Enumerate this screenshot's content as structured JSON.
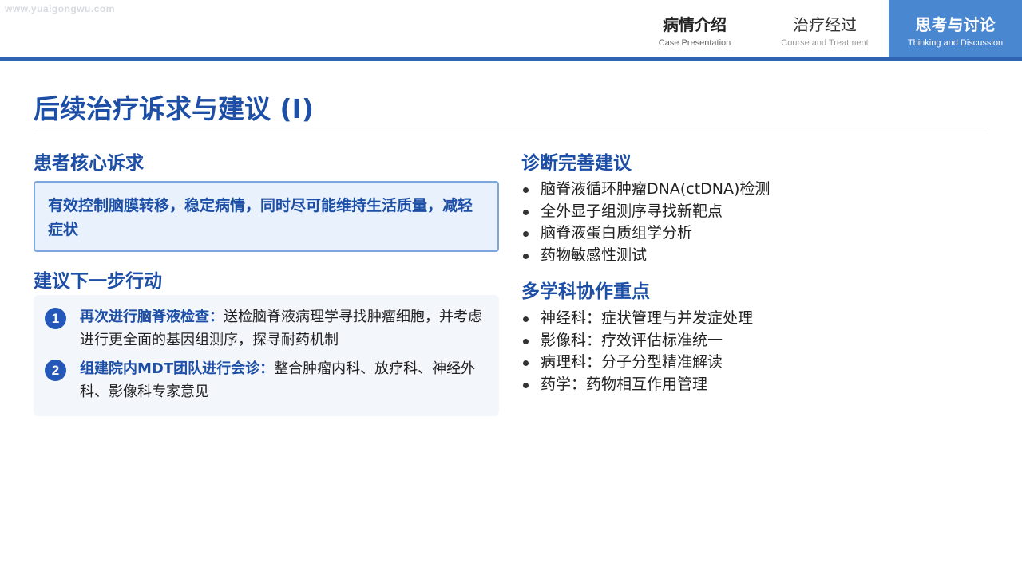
{
  "watermark": "www.yuaigongwu.com",
  "nav": {
    "tabs": [
      {
        "zh": "病情介绍",
        "en": "Case Presentation"
      },
      {
        "zh": "治疗经过",
        "en": "Course and Treatment"
      },
      {
        "zh": "思考与讨论",
        "en": "Thinking and Discussion"
      }
    ],
    "active_index": 2
  },
  "title": "后续治疗诉求与建议 (I)",
  "core": {
    "heading": "患者核心诉求",
    "text": "有效控制脑膜转移，稳定病情，同时尽可能维持生活质量，减轻症状"
  },
  "actions": {
    "heading": "建议下一步行动",
    "items": [
      {
        "num": "1",
        "bold": "再次进行脑脊液检查：",
        "text": "送检脑脊液病理学寻找肿瘤细胞，并考虑进行更全面的基因组测序，探寻耐药机制"
      },
      {
        "num": "2",
        "bold": "组建院内MDT团队进行会诊：",
        "text": "整合肿瘤内科、放疗科、神经外科、影像科专家意见"
      }
    ]
  },
  "diagnosis": {
    "heading": "诊断完善建议",
    "items": [
      "脑脊液循环肿瘤DNA(ctDNA)检测",
      "全外显子组测序寻找新靶点",
      "脑脊液蛋白质组学分析",
      "药物敏感性测试"
    ]
  },
  "mdt": {
    "heading": "多学科协作重点",
    "items": [
      "神经科：症状管理与并发症处理",
      "影像科：疗效评估标准统一",
      "病理科：分子分型精准解读",
      "药学：药物相互作用管理"
    ]
  },
  "colors": {
    "accent": "#1d4fa6",
    "nav_active": "#4a87d1",
    "top_bar": "#2f64b3",
    "core_bg": "#e9f1fc",
    "core_border": "#7ea6dc",
    "action_bg": "#f3f6fb"
  }
}
